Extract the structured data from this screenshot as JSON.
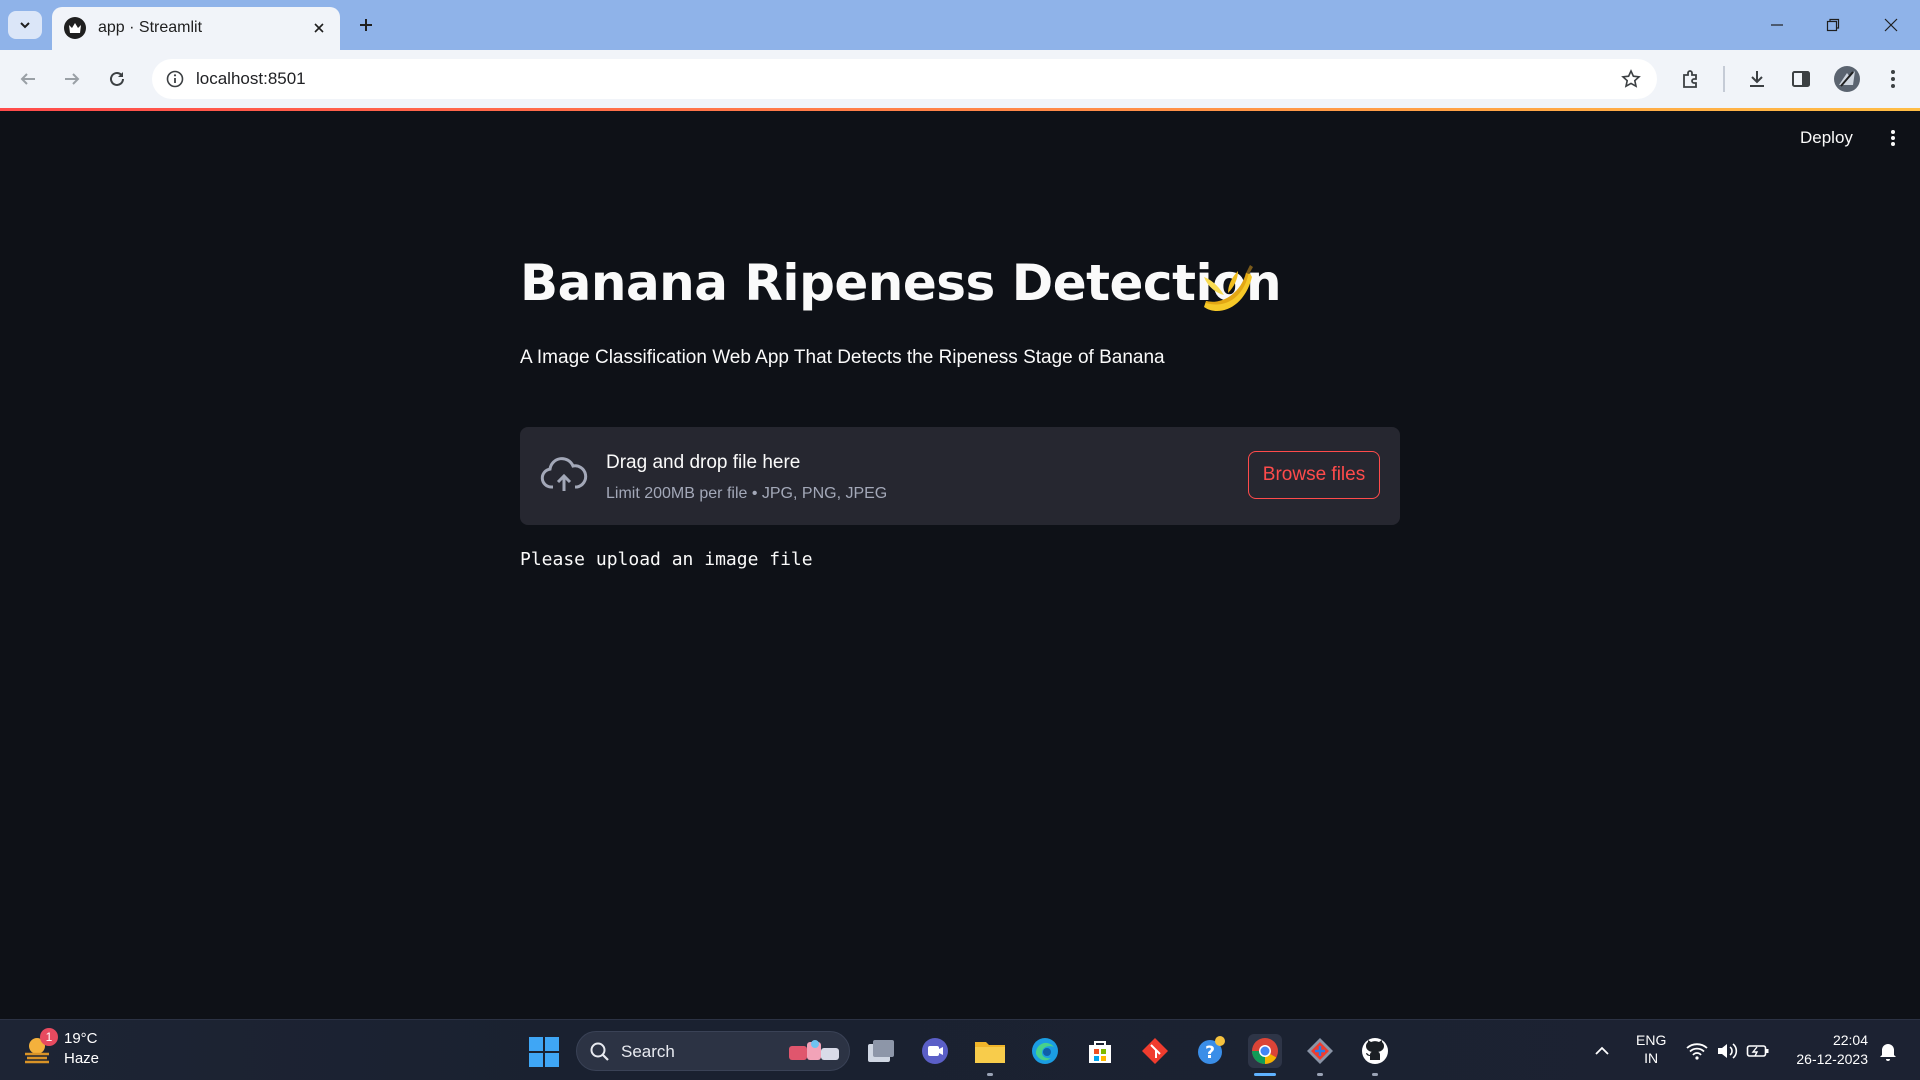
{
  "browser": {
    "tab_title": "app · Streamlit",
    "url": "localhost:8501"
  },
  "app": {
    "deploy_label": "Deploy",
    "title": "Banana Ripeness Detection",
    "title_emoji": "banana",
    "subtitle": "A Image Classification Web App That Detects the Ripeness Stage of Banana",
    "uploader": {
      "drop_text": "Drag and drop file here",
      "limit_text": "Limit 200MB per file • JPG, PNG, JPEG",
      "browse_label": "Browse files"
    },
    "status_message": "Please upload an image file",
    "colors": {
      "background": "#0e1117",
      "uploader_bg": "#262730",
      "accent": "#ff4b4b",
      "text": "#fafafa"
    }
  },
  "taskbar": {
    "weather": {
      "temp": "19°C",
      "condition": "Haze",
      "badge": "1"
    },
    "search_label": "Search",
    "apps": [
      "windows-start",
      "task-view",
      "teams-chat",
      "file-explorer",
      "edge",
      "microsoft-store",
      "git",
      "help",
      "chrome",
      "git-gui",
      "github-desktop"
    ],
    "lang_primary": "ENG",
    "lang_secondary": "IN",
    "time": "22:04",
    "date": "26-12-2023"
  }
}
